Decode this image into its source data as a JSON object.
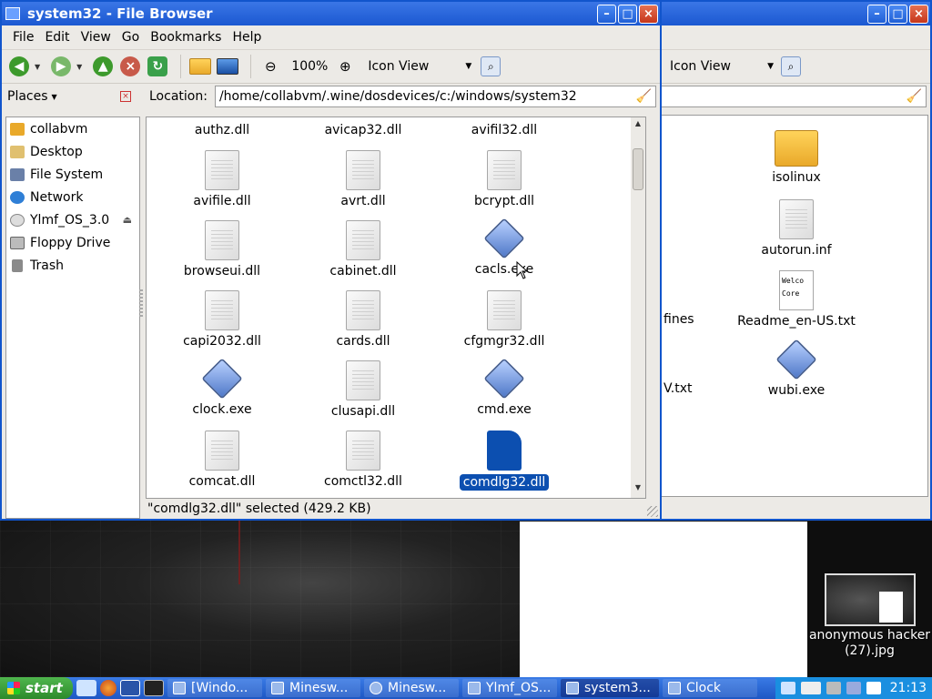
{
  "main_window": {
    "title": "system32 - File Browser",
    "menu": [
      "File",
      "Edit",
      "View",
      "Go",
      "Bookmarks",
      "Help"
    ],
    "toolbar": {
      "zoom": "100%",
      "view_mode": "Icon View"
    },
    "places_label": "Places",
    "location_label": "Location:",
    "location_value": "/home/collabvm/.wine/dosdevices/c:/windows/system32",
    "sidebar": [
      {
        "label": "collabvm",
        "icon": "home-folder-icon"
      },
      {
        "label": "Desktop",
        "icon": "desktop-icon"
      },
      {
        "label": "File System",
        "icon": "drive-icon"
      },
      {
        "label": "Network",
        "icon": "network-icon"
      },
      {
        "label": "Ylmf_OS_3.0",
        "icon": "cdrom-icon"
      },
      {
        "label": "Floppy Drive",
        "icon": "floppy-icon"
      },
      {
        "label": "Trash",
        "icon": "trash-icon"
      }
    ],
    "files": [
      {
        "name": "authz.dll",
        "type": "doc"
      },
      {
        "name": "avicap32.dll",
        "type": "doc"
      },
      {
        "name": "avifil32.dll",
        "type": "doc"
      },
      {
        "name": "avifile.dll",
        "type": "doc"
      },
      {
        "name": "avrt.dll",
        "type": "doc"
      },
      {
        "name": "bcrypt.dll",
        "type": "doc"
      },
      {
        "name": "browseui.dll",
        "type": "doc"
      },
      {
        "name": "cabinet.dll",
        "type": "doc"
      },
      {
        "name": "cacls.exe",
        "type": "exe"
      },
      {
        "name": "capi2032.dll",
        "type": "doc"
      },
      {
        "name": "cards.dll",
        "type": "doc"
      },
      {
        "name": "cfgmgr32.dll",
        "type": "doc"
      },
      {
        "name": "clock.exe",
        "type": "exe"
      },
      {
        "name": "clusapi.dll",
        "type": "doc"
      },
      {
        "name": "cmd.exe",
        "type": "exe"
      },
      {
        "name": "comcat.dll",
        "type": "doc"
      },
      {
        "name": "comctl32.dll",
        "type": "doc"
      },
      {
        "name": "comdlg32.dll",
        "type": "sel"
      }
    ],
    "status": "\"comdlg32.dll\" selected (429.2 KB)"
  },
  "back_window": {
    "view_mode": "Icon View",
    "files": [
      {
        "name": "isolinux",
        "type": "folder"
      },
      {
        "name": "autorun.inf",
        "type": "doc"
      },
      {
        "name": "Readme_en-US.txt",
        "type": "txt",
        "preview": "Welco\nCore"
      },
      {
        "name": "wubi.exe",
        "type": "exe"
      }
    ],
    "partial_labels": [
      "fines",
      "V.txt"
    ]
  },
  "desktop_icon": {
    "label": "anonymous hacker (27).jpg"
  },
  "taskbar": {
    "start": "start",
    "tasks": [
      "[Windo...",
      "Minesw...",
      "Minesw...",
      "Ylmf_OS...",
      "system3...",
      "Clock"
    ],
    "clock": "21:13"
  },
  "colors": {
    "title_blue": "#1b58d1",
    "selection": "#0c4fb0",
    "taskbar": "#2a6ad8"
  }
}
